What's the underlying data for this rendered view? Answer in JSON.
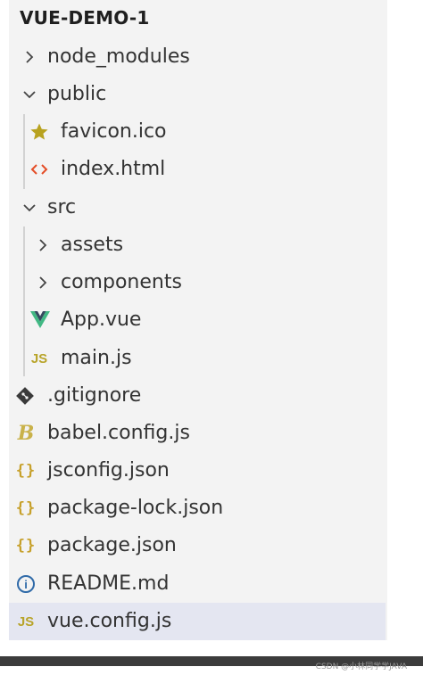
{
  "explorer": {
    "root_title": "VUE-DEMO-1",
    "items": [
      {
        "label": "node_modules",
        "icon": "chevron-right-icon"
      },
      {
        "label": "public",
        "icon": "chevron-down-icon"
      },
      {
        "label": "favicon.ico",
        "icon": "star-icon"
      },
      {
        "label": "index.html",
        "icon": "html-icon"
      },
      {
        "label": "src",
        "icon": "chevron-down-icon"
      },
      {
        "label": "assets",
        "icon": "chevron-right-icon"
      },
      {
        "label": "components",
        "icon": "chevron-right-icon"
      },
      {
        "label": "App.vue",
        "icon": "vue-icon"
      },
      {
        "label": "main.js",
        "icon": "js-icon",
        "icon_text": "JS"
      },
      {
        "label": ".gitignore",
        "icon": "git-icon"
      },
      {
        "label": "babel.config.js",
        "icon": "babel-icon",
        "icon_text": "B"
      },
      {
        "label": "jsconfig.json",
        "icon": "json-icon",
        "icon_text": "{}"
      },
      {
        "label": "package-lock.json",
        "icon": "json-icon",
        "icon_text": "{}"
      },
      {
        "label": "package.json",
        "icon": "json-icon",
        "icon_text": "{}"
      },
      {
        "label": "README.md",
        "icon": "info-icon",
        "icon_text": "i"
      },
      {
        "label": "vue.config.js",
        "icon": "js-icon",
        "icon_text": "JS",
        "selected": true
      }
    ]
  },
  "watermark": "CSDN @小林同学学JAVA",
  "colors": {
    "panel_bg": "#f3f3f3",
    "selected_bg": "#e4e6f1",
    "js_yellow": "#b8a42a",
    "json_yellow": "#c7a12c",
    "vue_green": "#41b883",
    "html_orange": "#e44d26",
    "git_dark": "#3a3a3a",
    "info_blue": "#2f6aa8"
  }
}
